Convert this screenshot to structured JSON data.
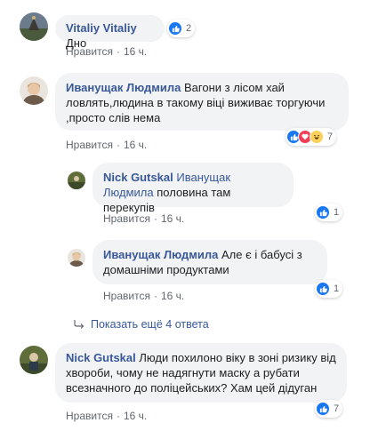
{
  "colors": {
    "link": "#385898",
    "bubble": "#f2f3f5",
    "like": "#1877f2",
    "love": "#f33e58",
    "haha": "#fcd15b",
    "meta": "#606770"
  },
  "action_like_label": "Нравится",
  "separator": "·",
  "comments": [
    {
      "author": "Vitaliy Vitaliy",
      "text": "Дно",
      "time": "16 ч.",
      "reactions": [
        "like"
      ],
      "reaction_count": "2"
    },
    {
      "author": "Иванущак Людмила",
      "text": "Вагони з лісом хай ловлять,людина в такому віці виживає торгуючи ,просто слів нема",
      "time": "16 ч.",
      "reactions": [
        "like",
        "love",
        "haha"
      ],
      "reaction_count": "7",
      "replies": [
        {
          "author": "Nick Gutskal",
          "mention": "Иванущак Людмила",
          "text": "половина там перекупів",
          "time": "16 ч.",
          "reactions": [
            "like"
          ],
          "reaction_count": "1"
        },
        {
          "author": "Иванущак Людмила",
          "text": "Але є і бабусі з домашніми продуктами",
          "time": "16 ч.",
          "reactions": [
            "like"
          ],
          "reaction_count": "1"
        }
      ],
      "more_replies_label": "Показать ещё 4 ответа"
    },
    {
      "author": "Nick Gutskal",
      "text": "Люди похилоно віку в зоні ризику від хвороби, чому не надягнути маску а рубати всезначного до поліцейських? Хам цей дідуган",
      "time": "16 ч.",
      "reactions": [
        "like"
      ],
      "reaction_count": "7"
    }
  ]
}
